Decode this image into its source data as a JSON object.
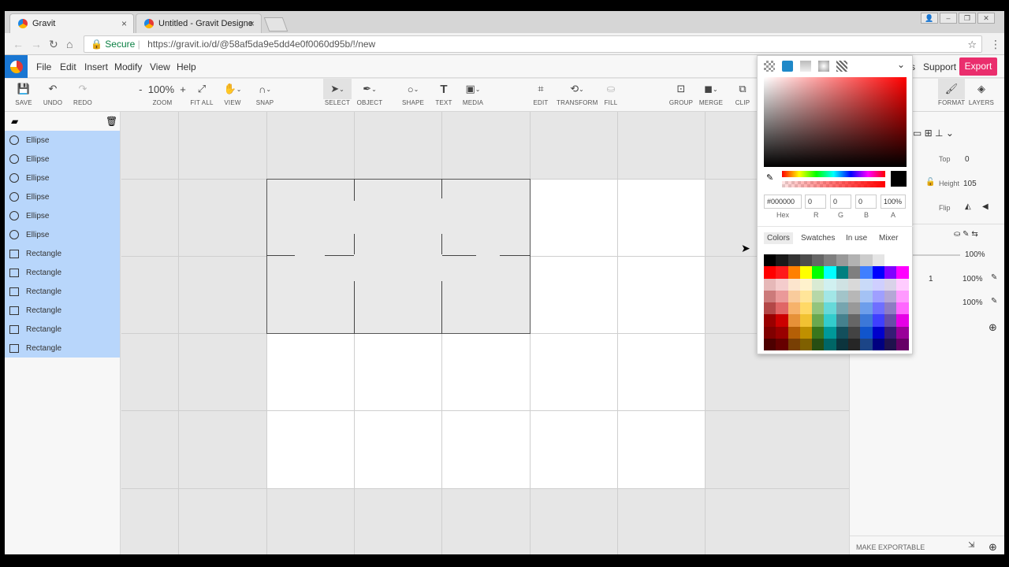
{
  "browser": {
    "tabs": [
      {
        "title": "Gravit",
        "active": true
      },
      {
        "title": "Untitled - Gravit Designe",
        "active": false
      }
    ],
    "secure_label": "Secure",
    "url": "https://gravit.io/d/@58af5da9e5dd4e0f0060d95b/!/new"
  },
  "menu": {
    "items": [
      "File",
      "Edit",
      "Insert",
      "Modify",
      "View",
      "Help"
    ],
    "support": "Support",
    "export": "Export",
    "partial_s": "s"
  },
  "toolbar": {
    "save": "SAVE",
    "undo": "UNDO",
    "redo": "REDO",
    "zoom_minus": "-",
    "zoom_value": "100%",
    "zoom_plus": "+",
    "zoom": "ZOOM",
    "fit_all": "FIT ALL",
    "view": "VIEW",
    "snap": "SNAP",
    "select": "SELECT",
    "object": "OBJECT",
    "shape": "SHAPE",
    "text": "TEXT",
    "media": "MEDIA",
    "edit": "EDIT",
    "transform": "TRANSFORM",
    "fill": "FILL",
    "group": "GROUP",
    "merge": "MERGE",
    "clip": "CLIP",
    "format": "FORMAT",
    "layers": "LAYERS"
  },
  "layers": [
    {
      "type": "ellipse",
      "name": "Ellipse"
    },
    {
      "type": "ellipse",
      "name": "Ellipse"
    },
    {
      "type": "ellipse",
      "name": "Ellipse"
    },
    {
      "type": "ellipse",
      "name": "Ellipse"
    },
    {
      "type": "ellipse",
      "name": "Ellipse"
    },
    {
      "type": "ellipse",
      "name": "Ellipse"
    },
    {
      "type": "rectangle",
      "name": "Rectangle"
    },
    {
      "type": "rectangle",
      "name": "Rectangle"
    },
    {
      "type": "rectangle",
      "name": "Rectangle"
    },
    {
      "type": "rectangle",
      "name": "Rectangle"
    },
    {
      "type": "rectangle",
      "name": "Rectangle"
    },
    {
      "type": "rectangle",
      "name": "Rectangle"
    }
  ],
  "right_panel": {
    "top_label": "Top",
    "top_value": "0",
    "height_label": "Height",
    "height_value": "105",
    "flip_label": "Flip",
    "opacity": "100%",
    "border_width": "1",
    "border_opacity": "100%",
    "fill_opacity": "100%",
    "make_exportable": "MAKE EXPORTABLE"
  },
  "color_picker": {
    "hex": "#000000",
    "r": "0",
    "g": "0",
    "b": "0",
    "a": "100%",
    "labels": {
      "hex": "Hex",
      "r": "R",
      "g": "G",
      "b": "B",
      "a": "A"
    },
    "tabs": [
      "Colors",
      "Swatches",
      "In use",
      "Mixer"
    ],
    "active_tab": "Colors",
    "selected_color": "#000000",
    "palette": [
      [
        "#000000",
        "#191919",
        "#333333",
        "#4c4c4c",
        "#666666",
        "#7f7f7f",
        "#999999",
        "#b2b2b2",
        "#cccccc",
        "#e5e5e5",
        "#ffffff",
        "#ffffff"
      ],
      [
        "#ff0000",
        "#ff1a1a",
        "#ff8000",
        "#ffff00",
        "#00ff00",
        "#00ffff",
        "#008080",
        "#7f7f7f",
        "#3f7fff",
        "#0000ff",
        "#8000ff",
        "#ff00ff"
      ],
      [
        "#e6b8b8",
        "#f4cccc",
        "#fce5cd",
        "#fff2cc",
        "#d9ead3",
        "#d0f0f0",
        "#cfe2e3",
        "#d9d9d9",
        "#c9daf8",
        "#cfcfff",
        "#d9d2e9",
        "#ffccff"
      ],
      [
        "#cc7a7a",
        "#ea9999",
        "#f9cb9c",
        "#ffe599",
        "#b6d7a8",
        "#a2e6e6",
        "#a2c4c9",
        "#b7b7b7",
        "#a4c2f4",
        "#9f9fff",
        "#b4a7d6",
        "#ff99ff"
      ],
      [
        "#b34747",
        "#e06666",
        "#f6b26b",
        "#ffd966",
        "#93c47d",
        "#66d9d9",
        "#76a5af",
        "#999999",
        "#6d9eeb",
        "#6f6fff",
        "#8e7cc3",
        "#ff66ff"
      ],
      [
        "#990000",
        "#cc0000",
        "#e69138",
        "#f1c232",
        "#6aa84f",
        "#33cccc",
        "#45818e",
        "#666666",
        "#3c78d8",
        "#3f3fff",
        "#674ea7",
        "#e600e6"
      ],
      [
        "#800000",
        "#990000",
        "#b45f06",
        "#bf9000",
        "#38761d",
        "#009999",
        "#134f5c",
        "#434343",
        "#1155cc",
        "#0000cc",
        "#351c75",
        "#990099"
      ],
      [
        "#4d0000",
        "#660000",
        "#783f04",
        "#7f6000",
        "#274e13",
        "#006666",
        "#0c343d",
        "#262626",
        "#1c4587",
        "#000080",
        "#20124d",
        "#660066"
      ]
    ]
  }
}
